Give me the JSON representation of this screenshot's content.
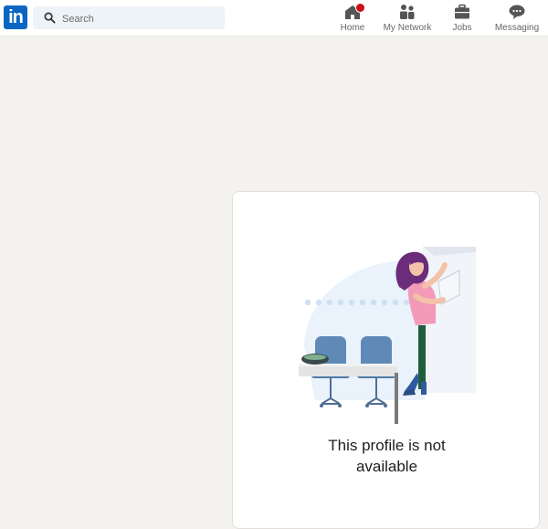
{
  "brand": {
    "logo_text": "in",
    "color": "#0a66c2"
  },
  "search": {
    "placeholder": "Search",
    "icon": "search-icon"
  },
  "nav": [
    {
      "label": "Home",
      "icon": "home-icon",
      "has_notification_badge": true
    },
    {
      "label": "My Network",
      "icon": "network-icon"
    },
    {
      "label": "Jobs",
      "icon": "briefcase-icon"
    },
    {
      "label": "Messaging",
      "icon": "chat-icon"
    }
  ],
  "profile_card": {
    "message_line1": "This profile is not",
    "message_line2": "available",
    "illustration": "person-leaning-by-chairs-illustration"
  },
  "colors": {
    "background": "#f3f2ef",
    "badge": "#cc1016",
    "search_bg": "#eef3f8"
  }
}
